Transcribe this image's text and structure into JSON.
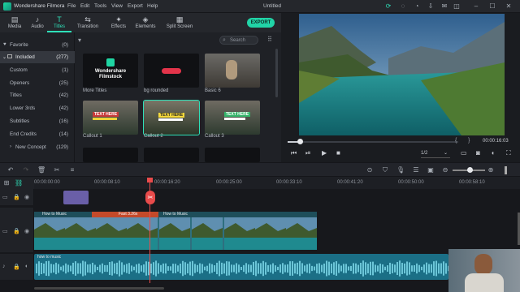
{
  "app": {
    "name": "Wondershare Filmora",
    "document": "Untitled"
  },
  "menu": [
    "File",
    "Edit",
    "Tools",
    "View",
    "Export",
    "Help"
  ],
  "tabs": [
    {
      "label": "Media",
      "icon": "media-icon"
    },
    {
      "label": "Audio",
      "icon": "music-note-icon"
    },
    {
      "label": "Titles",
      "icon": "titles-icon",
      "active": true
    },
    {
      "label": "Transition",
      "icon": "transition-icon"
    },
    {
      "label": "Effects",
      "icon": "effects-icon"
    },
    {
      "label": "Elements",
      "icon": "elements-icon"
    },
    {
      "label": "Split Screen",
      "icon": "split-screen-icon"
    }
  ],
  "export_label": "EXPORT",
  "categories": [
    {
      "name": "Favorite",
      "count": "(0)",
      "icon": "heart-icon"
    },
    {
      "name": "Included",
      "count": "(277)",
      "selected": true
    },
    {
      "name": "Custom",
      "count": "(1)"
    },
    {
      "name": "Openers",
      "count": "(25)"
    },
    {
      "name": "Titles",
      "count": "(42)"
    },
    {
      "name": "Lower 3rds",
      "count": "(42)"
    },
    {
      "name": "Subtitles",
      "count": "(16)"
    },
    {
      "name": "End Credits",
      "count": "(14)"
    },
    {
      "name": "New Concept",
      "count": "(129)"
    }
  ],
  "search": {
    "placeholder": "Search"
  },
  "assets": [
    {
      "label": "More Titles",
      "thumb_text": "Wondershare Filmstock"
    },
    {
      "label": "bg rounded"
    },
    {
      "label": "Basic 6"
    },
    {
      "label": "Callout 1",
      "thumb_text": "TEXT HERE"
    },
    {
      "label": "Callout 2",
      "thumb_text": "TEXT HERE",
      "selected": true
    },
    {
      "label": "Callout 3",
      "thumb_text": "TEXT HERE"
    }
  ],
  "player": {
    "time_bracket_left": "{",
    "time_bracket_right": "}",
    "timecode": "00:00:16:03",
    "quality": "1/2",
    "progress": 0.07
  },
  "ruler_ticks": [
    "00:00:00:00",
    "00:00:08:10",
    "00:00:16:20",
    "00:00:25:00",
    "00:00:33:10",
    "00:00:41:20",
    "00:00:50:00",
    "00:00:58:10"
  ],
  "clips": {
    "video_label": "How to Music",
    "speed_label": "Fast 3.26x",
    "audio_label": "how to music"
  },
  "colors": {
    "accent": "#2fe0b9",
    "audio": "#1b6f86",
    "playhead": "#e94b4b",
    "title_clip": "#6a5fa8"
  }
}
